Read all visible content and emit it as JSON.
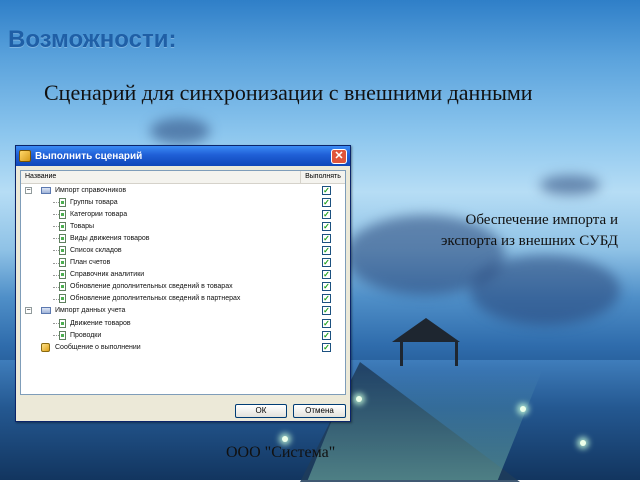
{
  "slide": {
    "heading": "Возможности:",
    "subheading": "Сценарий для синхронизации с внешними данными",
    "note_line1": "Обеспечение импорта и",
    "note_line2": "экспорта из внешних СУБД",
    "footer": "ООО \"Система\""
  },
  "dialog": {
    "title": "Выполнить сценарий",
    "close_label": "✕",
    "columns": {
      "name": "Название",
      "done": "Выполнять"
    },
    "rows": [
      {
        "label": "Импорт справочников",
        "level": 0,
        "kind": "group",
        "checked": true
      },
      {
        "label": "Группы товара",
        "level": 1,
        "kind": "item",
        "checked": true
      },
      {
        "label": "Категории товара",
        "level": 1,
        "kind": "item",
        "checked": true
      },
      {
        "label": "Товары",
        "level": 1,
        "kind": "item",
        "checked": true
      },
      {
        "label": "Виды движения товаров",
        "level": 1,
        "kind": "item",
        "checked": true
      },
      {
        "label": "Список складов",
        "level": 1,
        "kind": "item",
        "checked": true
      },
      {
        "label": "План счетов",
        "level": 1,
        "kind": "item",
        "checked": true
      },
      {
        "label": "Справочник аналитики",
        "level": 1,
        "kind": "item",
        "checked": true
      },
      {
        "label": "Обновление дополнительных сведений в товарах",
        "level": 1,
        "kind": "item",
        "checked": true
      },
      {
        "label": "Обновление дополнительных сведений в партнерах",
        "level": 1,
        "kind": "item",
        "checked": true
      },
      {
        "label": "Импорт данных учета",
        "level": 0,
        "kind": "group",
        "checked": true
      },
      {
        "label": "Движение товаров",
        "level": 1,
        "kind": "item",
        "checked": true
      },
      {
        "label": "Проводки",
        "level": 1,
        "kind": "item",
        "checked": true
      },
      {
        "label": "Сообщение о выполнении",
        "level": 0,
        "kind": "message",
        "checked": true
      }
    ],
    "ok_label": "ОК",
    "cancel_label": "Отмена"
  }
}
